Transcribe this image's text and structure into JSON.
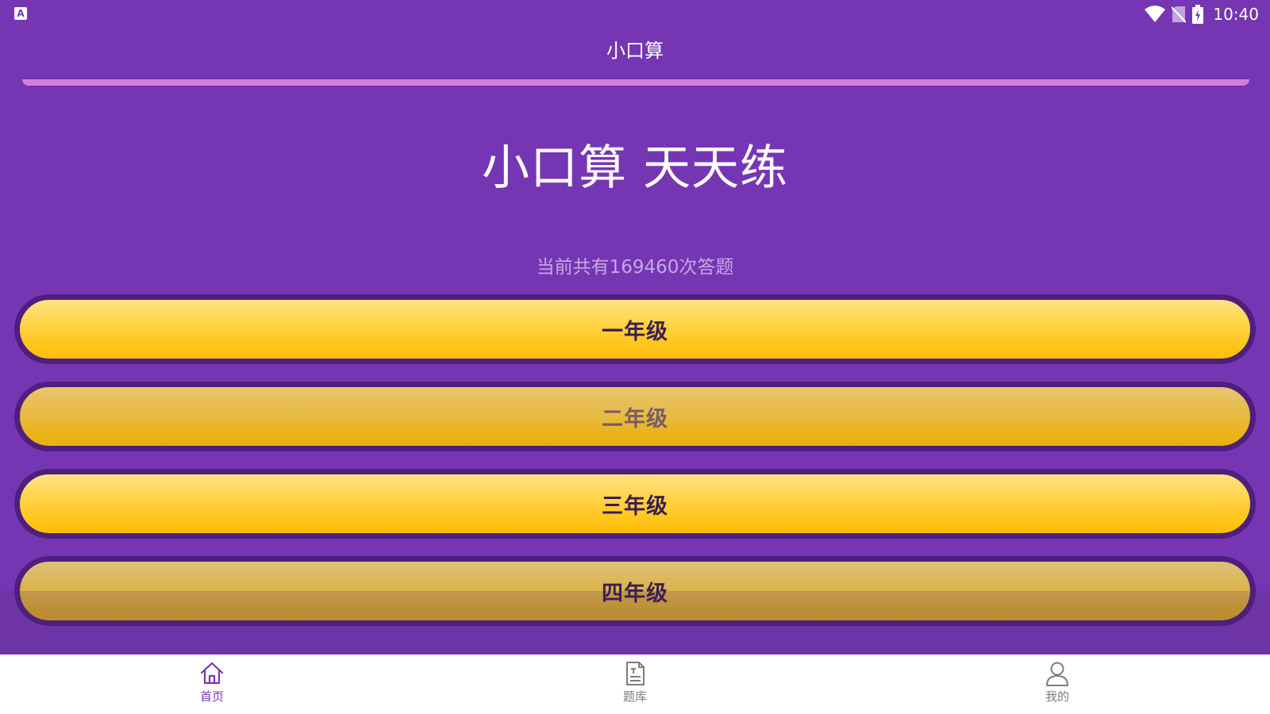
{
  "status_bar": {
    "notification_icon": "a-app-icon",
    "icons": [
      "wifi-icon",
      "no-sim-icon",
      "battery-charging-icon"
    ],
    "time": "10:40"
  },
  "header": {
    "title": "小口算"
  },
  "hero": {
    "title": "小口算 天天练",
    "answer_count": "当前共有169460次答题"
  },
  "grades": [
    {
      "label": "一年级"
    },
    {
      "label": "二年级"
    },
    {
      "label": "三年级"
    },
    {
      "label": "四年级"
    }
  ],
  "bottom_nav": {
    "items": [
      {
        "label": "首页",
        "icon": "home-icon",
        "active": true
      },
      {
        "label": "题库",
        "icon": "document-icon",
        "active": false
      },
      {
        "label": "我的",
        "icon": "user-icon",
        "active": false
      }
    ]
  },
  "colors": {
    "background": "#7636b3",
    "divider": "#d07fdc",
    "button_fill": "#ffc61b",
    "button_border": "#4e1f7e",
    "button_text": "#3b1d51",
    "nav_active": "#7636b3",
    "nav_inactive": "#7d7d7d"
  }
}
